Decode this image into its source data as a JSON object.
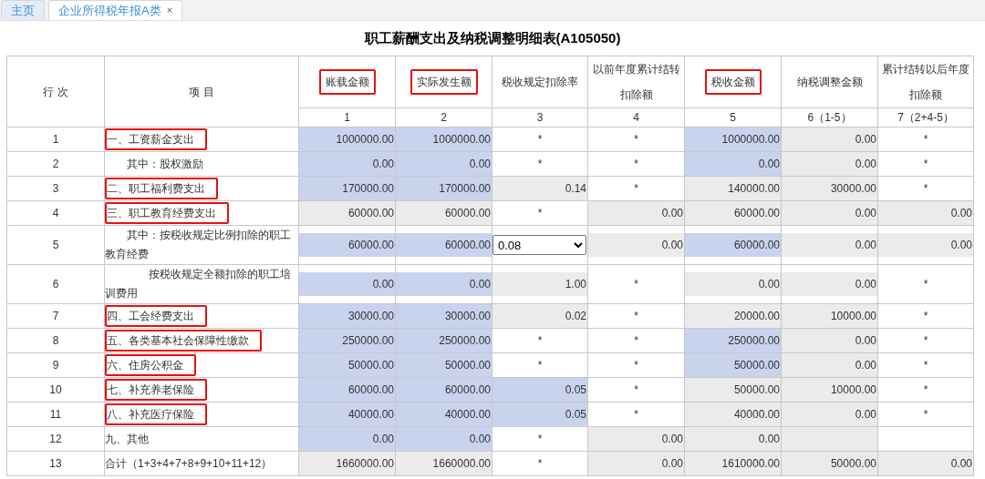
{
  "tabs": [
    {
      "label": "主页",
      "selected": false
    },
    {
      "label": "企业所得税年报A类",
      "selected": true,
      "close": "×"
    }
  ],
  "title": "职工薪酬支出及纳税调整明细表(A105050)",
  "table": {
    "columns": [
      {
        "label": "行 次"
      },
      {
        "label": "项 目"
      },
      {
        "label": "账载金额",
        "number": "1",
        "highlighted": true
      },
      {
        "label": "实际发生额",
        "number": "2",
        "highlighted": true
      },
      {
        "label": "税收规定扣除率",
        "number": "3",
        "highlighted": false
      },
      {
        "label": "以前年度累计结转扣除额",
        "number": "4",
        "highlighted": false
      },
      {
        "label": "税收金额",
        "number": "5",
        "highlighted": true
      },
      {
        "label": "纳税调整金额",
        "number": "6（1-5）",
        "highlighted": false
      },
      {
        "label": "累计结转以后年度扣除额",
        "number": "7（2+4-5）",
        "highlighted": false
      }
    ],
    "rows": [
      {
        "cells": [
          {
            "kind": "rowno",
            "value": "1"
          },
          {
            "kind": "item",
            "value": "一、工资薪金支出",
            "highlighted": true
          },
          {
            "kind": "input",
            "value": "1000000.00"
          },
          {
            "kind": "input",
            "value": "1000000.00"
          },
          {
            "kind": "na",
            "value": "*"
          },
          {
            "kind": "na",
            "value": "*"
          },
          {
            "kind": "input",
            "value": "1000000.00"
          },
          {
            "kind": "calc",
            "value": "0.00"
          },
          {
            "kind": "na",
            "value": "*"
          }
        ]
      },
      {
        "cells": [
          {
            "kind": "rowno",
            "value": "2"
          },
          {
            "kind": "item",
            "value": "　　其中：股权激励",
            "highlighted": false
          },
          {
            "kind": "input",
            "value": "0.00"
          },
          {
            "kind": "input",
            "value": "0.00"
          },
          {
            "kind": "na",
            "value": "*"
          },
          {
            "kind": "na",
            "value": "*"
          },
          {
            "kind": "input",
            "value": "0.00"
          },
          {
            "kind": "calc",
            "value": "0.00"
          },
          {
            "kind": "na",
            "value": "*"
          }
        ]
      },
      {
        "cells": [
          {
            "kind": "rowno",
            "value": "3"
          },
          {
            "kind": "item",
            "value": "二、职工福利费支出",
            "highlighted": true
          },
          {
            "kind": "input",
            "value": "170000.00"
          },
          {
            "kind": "input",
            "value": "170000.00"
          },
          {
            "kind": "calc",
            "value": "0.14"
          },
          {
            "kind": "na",
            "value": "*"
          },
          {
            "kind": "calc",
            "value": "140000.00"
          },
          {
            "kind": "calc",
            "value": "30000.00"
          },
          {
            "kind": "na",
            "value": "*"
          }
        ]
      },
      {
        "cells": [
          {
            "kind": "rowno",
            "value": "4"
          },
          {
            "kind": "item",
            "value": "三、职工教育经费支出",
            "highlighted": true
          },
          {
            "kind": "calc",
            "value": "60000.00"
          },
          {
            "kind": "calc",
            "value": "60000.00"
          },
          {
            "kind": "na",
            "value": "*"
          },
          {
            "kind": "calc",
            "value": "0.00"
          },
          {
            "kind": "calc",
            "value": "60000.00"
          },
          {
            "kind": "calc",
            "value": "0.00"
          },
          {
            "kind": "calc",
            "value": "0.00"
          }
        ]
      },
      {
        "cells": [
          {
            "kind": "rowno",
            "value": "5"
          },
          {
            "kind": "item",
            "value": "　　其中：按税收规定比例扣除的职工教育经费",
            "highlighted": false
          },
          {
            "kind": "input",
            "value": "60000.00"
          },
          {
            "kind": "input",
            "value": "60000.00"
          },
          {
            "kind": "select",
            "value": "0.08"
          },
          {
            "kind": "calc",
            "value": "0.00"
          },
          {
            "kind": "input",
            "value": "60000.00"
          },
          {
            "kind": "calc",
            "value": "0.00"
          },
          {
            "kind": "calc",
            "value": "0.00"
          }
        ]
      },
      {
        "cells": [
          {
            "kind": "rowno",
            "value": "6"
          },
          {
            "kind": "item",
            "value": "　　　　按税收规定全额扣除的职工培训费用",
            "highlighted": false
          },
          {
            "kind": "input",
            "value": "0.00"
          },
          {
            "kind": "input",
            "value": "0.00"
          },
          {
            "kind": "calc",
            "value": "1.00"
          },
          {
            "kind": "na",
            "value": "*"
          },
          {
            "kind": "calc",
            "value": "0.00"
          },
          {
            "kind": "calc",
            "value": "0.00"
          },
          {
            "kind": "na",
            "value": "*"
          }
        ]
      },
      {
        "cells": [
          {
            "kind": "rowno",
            "value": "7"
          },
          {
            "kind": "item",
            "value": "四、工会经费支出",
            "highlighted": true
          },
          {
            "kind": "input",
            "value": "30000.00"
          },
          {
            "kind": "input",
            "value": "30000.00"
          },
          {
            "kind": "calc",
            "value": "0.02"
          },
          {
            "kind": "na",
            "value": "*"
          },
          {
            "kind": "calc",
            "value": "20000.00"
          },
          {
            "kind": "calc",
            "value": "10000.00"
          },
          {
            "kind": "na",
            "value": "*"
          }
        ]
      },
      {
        "cells": [
          {
            "kind": "rowno",
            "value": "8"
          },
          {
            "kind": "item",
            "value": "五、各类基本社会保障性缴款",
            "highlighted": true
          },
          {
            "kind": "input",
            "value": "250000.00"
          },
          {
            "kind": "input",
            "value": "250000.00"
          },
          {
            "kind": "na",
            "value": "*"
          },
          {
            "kind": "na",
            "value": "*"
          },
          {
            "kind": "input",
            "value": "250000.00"
          },
          {
            "kind": "calc",
            "value": "0.00"
          },
          {
            "kind": "na",
            "value": "*"
          }
        ]
      },
      {
        "cells": [
          {
            "kind": "rowno",
            "value": "9"
          },
          {
            "kind": "item",
            "value": "六、住房公积金",
            "highlighted": true
          },
          {
            "kind": "input",
            "value": "50000.00"
          },
          {
            "kind": "input",
            "value": "50000.00"
          },
          {
            "kind": "na",
            "value": "*"
          },
          {
            "kind": "na",
            "value": "*"
          },
          {
            "kind": "input",
            "value": "50000.00"
          },
          {
            "kind": "calc",
            "value": "0.00"
          },
          {
            "kind": "na",
            "value": "*"
          }
        ]
      },
      {
        "cells": [
          {
            "kind": "rowno",
            "value": "10"
          },
          {
            "kind": "item",
            "value": "七、补充养老保险",
            "highlighted": true
          },
          {
            "kind": "input",
            "value": "60000.00"
          },
          {
            "kind": "input",
            "value": "60000.00"
          },
          {
            "kind": "input",
            "value": "0.05"
          },
          {
            "kind": "na",
            "value": "*"
          },
          {
            "kind": "calc",
            "value": "50000.00"
          },
          {
            "kind": "calc",
            "value": "10000.00"
          },
          {
            "kind": "na",
            "value": "*"
          }
        ]
      },
      {
        "cells": [
          {
            "kind": "rowno",
            "value": "11"
          },
          {
            "kind": "item",
            "value": "八、补充医疗保险",
            "highlighted": true
          },
          {
            "kind": "input",
            "value": "40000.00"
          },
          {
            "kind": "input",
            "value": "40000.00"
          },
          {
            "kind": "input",
            "value": "0.05"
          },
          {
            "kind": "na",
            "value": "*"
          },
          {
            "kind": "calc",
            "value": "40000.00"
          },
          {
            "kind": "calc",
            "value": "0.00"
          },
          {
            "kind": "na",
            "value": "*"
          }
        ]
      },
      {
        "cells": [
          {
            "kind": "rowno",
            "value": "12"
          },
          {
            "kind": "item",
            "value": "九、其他",
            "highlighted": false
          },
          {
            "kind": "input",
            "value": "0.00"
          },
          {
            "kind": "input",
            "value": "0.00"
          },
          {
            "kind": "na",
            "value": "*"
          },
          {
            "kind": "calc",
            "value": "0.00"
          },
          {
            "kind": "calc",
            "value": "0.00"
          },
          {
            "kind": "calc"
          },
          {
            "kind": "na"
          }
        ]
      },
      {
        "cells": [
          {
            "kind": "rowno",
            "value": "13"
          },
          {
            "kind": "item",
            "value": "合计（1+3+4+7+8+9+10+11+12）",
            "highlighted": false
          },
          {
            "kind": "calc",
            "value": "1660000.00"
          },
          {
            "kind": "calc",
            "value": "1660000.00"
          },
          {
            "kind": "na",
            "value": "*"
          },
          {
            "kind": "calc",
            "value": "0.00"
          },
          {
            "kind": "calc",
            "value": "1610000.00"
          },
          {
            "kind": "calc",
            "value": "50000.00"
          },
          {
            "kind": "calc",
            "value": "0.00"
          }
        ]
      }
    ]
  }
}
